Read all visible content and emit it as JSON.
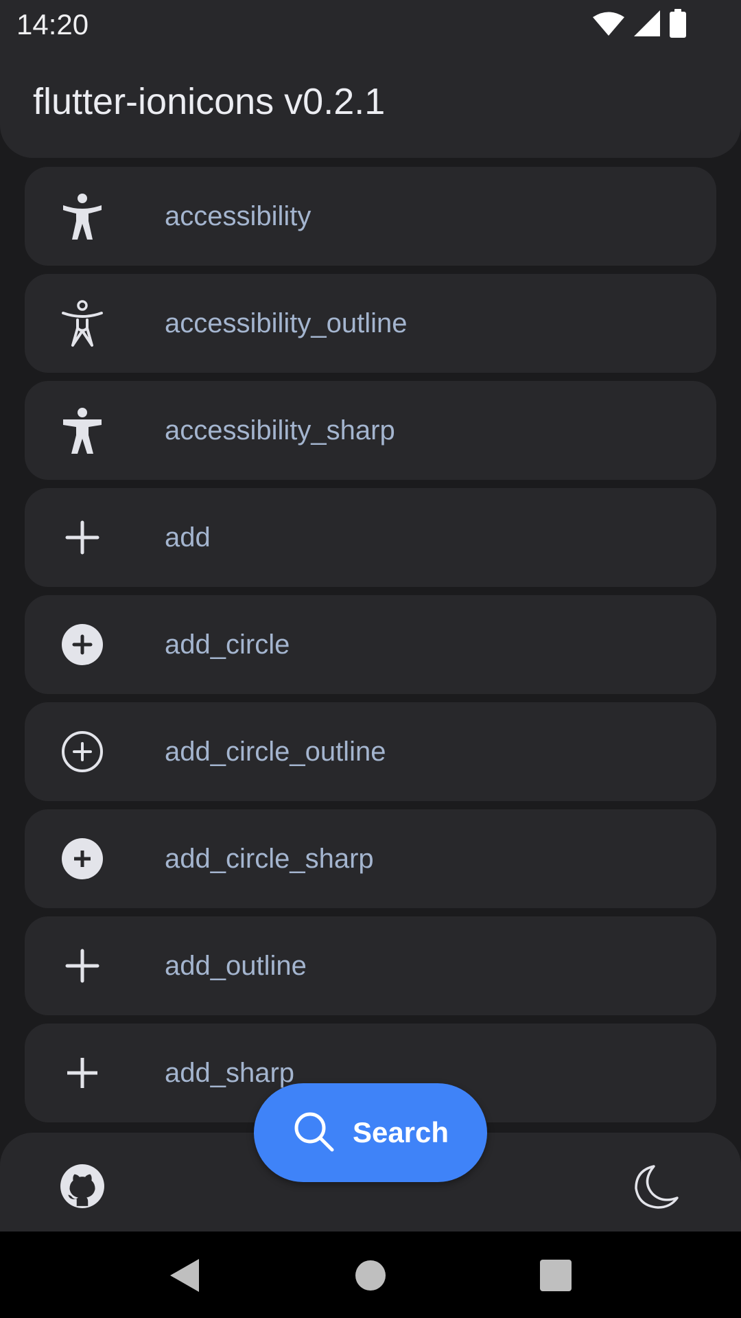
{
  "status_bar": {
    "time": "14:20",
    "icons": [
      "wifi-icon",
      "signal-icon",
      "battery-icon"
    ]
  },
  "app_bar": {
    "title": "flutter-ionicons v0.2.1"
  },
  "icon_list": {
    "items": [
      {
        "label": "accessibility",
        "icon": "accessibility-icon"
      },
      {
        "label": "accessibility_outline",
        "icon": "accessibility-outline-icon"
      },
      {
        "label": "accessibility_sharp",
        "icon": "accessibility-sharp-icon"
      },
      {
        "label": "add",
        "icon": "add-icon"
      },
      {
        "label": "add_circle",
        "icon": "add-circle-icon"
      },
      {
        "label": "add_circle_outline",
        "icon": "add-circle-outline-icon"
      },
      {
        "label": "add_circle_sharp",
        "icon": "add-circle-sharp-icon"
      },
      {
        "label": "add_outline",
        "icon": "add-outline-icon"
      },
      {
        "label": "add_sharp",
        "icon": "add-sharp-icon"
      }
    ]
  },
  "search_button": {
    "label": "Search",
    "icon": "search-icon"
  },
  "bottom_bar": {
    "left_icon": "github-icon",
    "right_icon": "moon-icon"
  },
  "nav_bar": {
    "icons": [
      "back-icon",
      "home-icon",
      "recents-icon"
    ]
  },
  "colors": {
    "background": "#1b1b1d",
    "surface": "#28282b",
    "label": "#a4b5cf",
    "accent": "#3f83f8",
    "icon": "#e3e4ea"
  }
}
